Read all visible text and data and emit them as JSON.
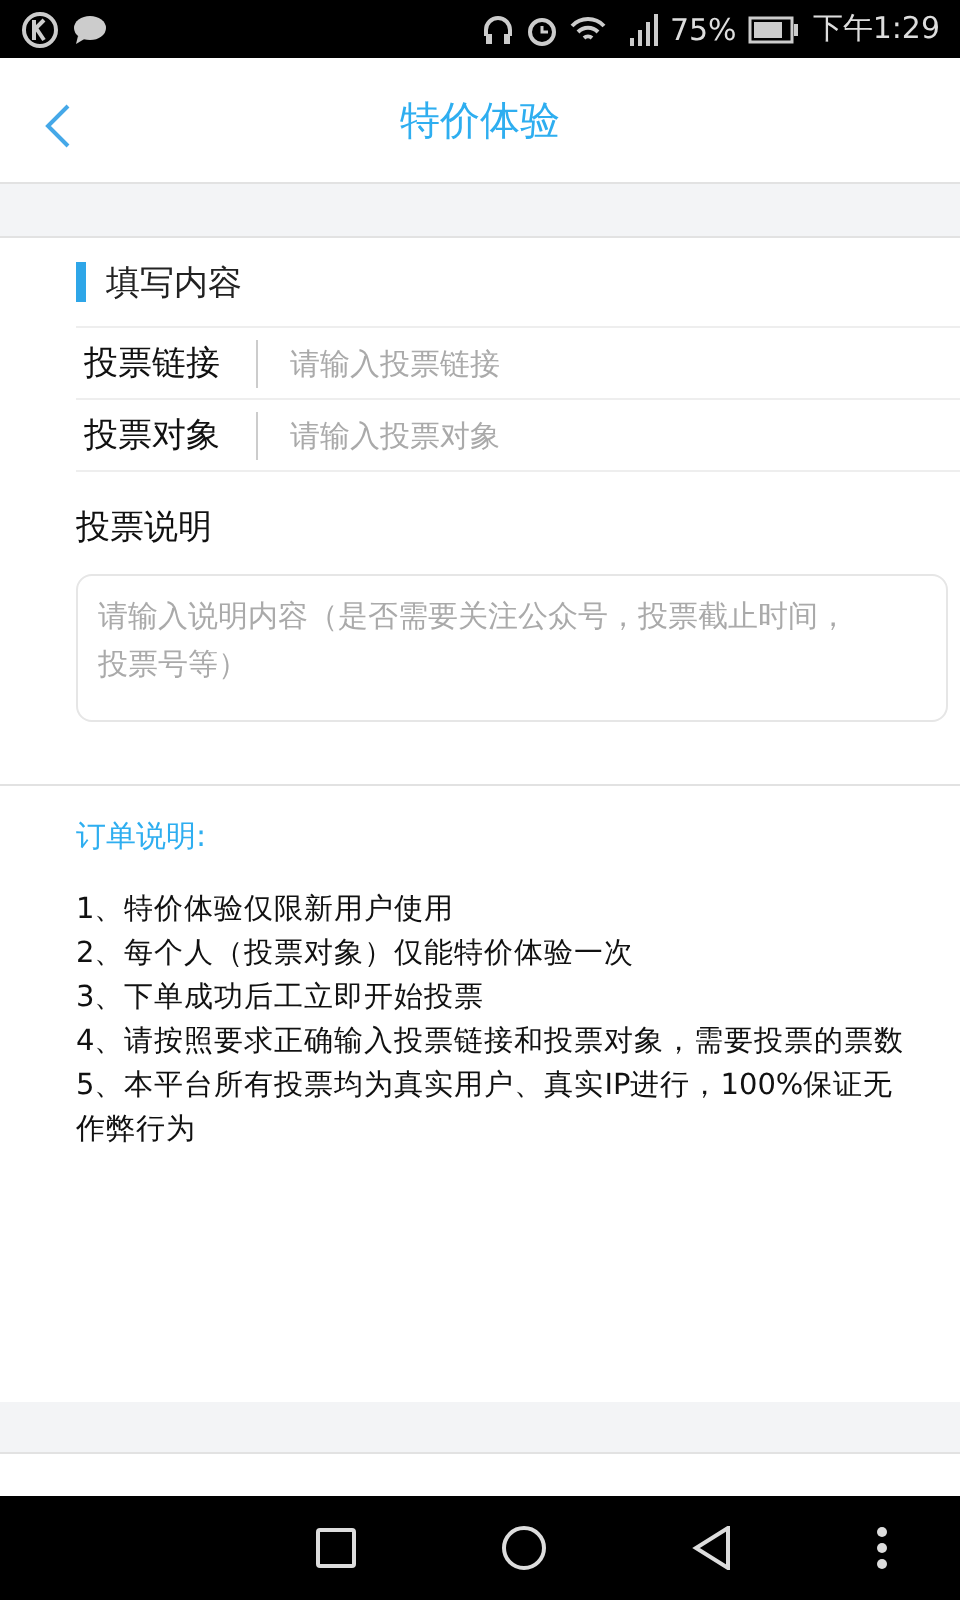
{
  "status_bar": {
    "battery": "75%",
    "time": "下午1:29"
  },
  "header": {
    "title": "特价体验"
  },
  "form": {
    "section_title": "填写内容",
    "fields": [
      {
        "label": "投票链接",
        "placeholder": "请输入投票链接"
      },
      {
        "label": "投票对象",
        "placeholder": "请输入投票对象"
      }
    ],
    "description": {
      "label": "投票说明",
      "placeholder": "请输入说明内容（是否需要关注公众号，投票截止时间，投票号等）"
    }
  },
  "order_notes": {
    "title": "订单说明:",
    "items": [
      "1、特价体验仅限新用户使用",
      "2、每个人（投票对象）仅能特价体验一次",
      "3、下单成功后工立即开始投票",
      "4、请按照要求正确输入投票链接和投票对象，需要投票的票数",
      "5、本平台所有投票均为真实用户、真实IP进行，100%保证无作弊行为"
    ]
  }
}
